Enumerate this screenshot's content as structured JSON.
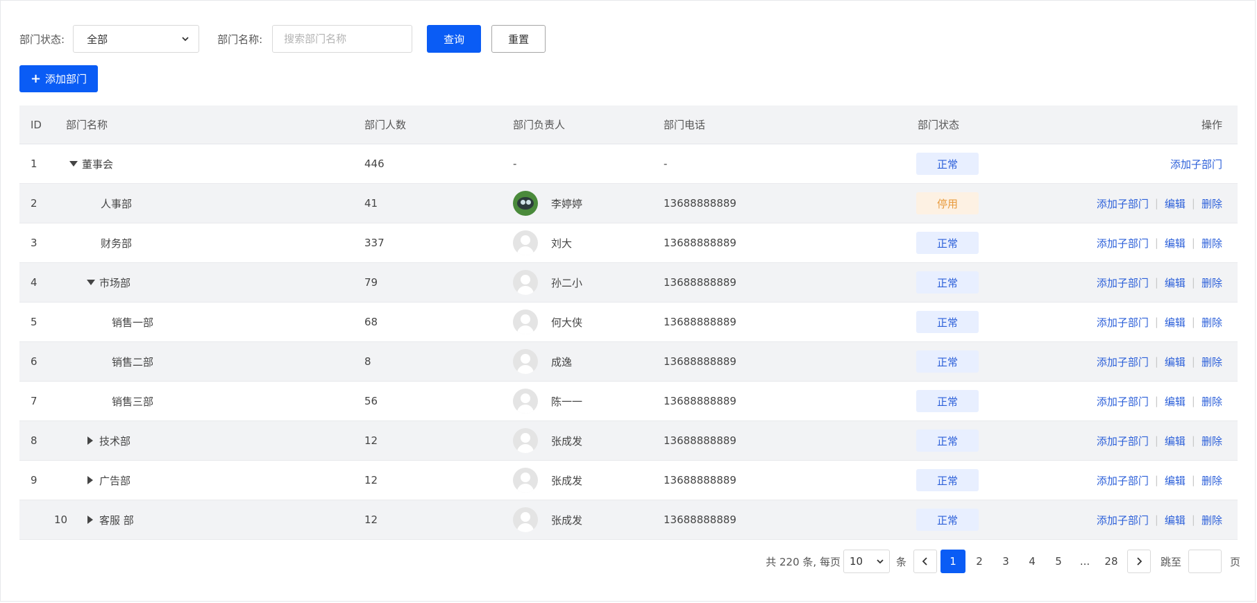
{
  "filters": {
    "status_label": "部门状态:",
    "status_value": "全部",
    "name_label": "部门名称:",
    "name_placeholder": "搜索部门名称",
    "query_button": "查询",
    "reset_button": "重置"
  },
  "add_button": "添加部门",
  "table": {
    "headers": {
      "id": "ID",
      "name": "部门名称",
      "count": "部门人数",
      "owner": "部门负责人",
      "phone": "部门电话",
      "status": "部门状态",
      "ops": "操作"
    },
    "op_labels": {
      "add_child": "添加子部门",
      "edit": "编辑",
      "delete": "删除",
      "separator": "|"
    },
    "rows": [
      {
        "id": "1",
        "name": "董事会",
        "count": "446",
        "owner": "-",
        "phone": "-",
        "status": "正常"
      },
      {
        "id": "2",
        "name": "人事部",
        "count": "41",
        "owner": "李婷婷",
        "phone": "13688888889",
        "status": "停用"
      },
      {
        "id": "3",
        "name": "财务部",
        "count": "337",
        "owner": "刘大",
        "phone": "13688888889",
        "status": "正常"
      },
      {
        "id": "4",
        "name": "市场部",
        "count": "79",
        "owner": "孙二小",
        "phone": "13688888889",
        "status": "正常"
      },
      {
        "id": "5",
        "name": "销售一部",
        "count": "68",
        "owner": "何大侠",
        "phone": "13688888889",
        "status": "正常"
      },
      {
        "id": "6",
        "name": "销售二部",
        "count": "8",
        "owner": "成逸",
        "phone": "13688888889",
        "status": "正常"
      },
      {
        "id": "7",
        "name": "销售三部",
        "count": "56",
        "owner": "陈一一",
        "phone": "13688888889",
        "status": "正常"
      },
      {
        "id": "8",
        "name": "技术部",
        "count": "12",
        "owner": "张成发",
        "phone": "13688888889",
        "status": "正常"
      },
      {
        "id": "9",
        "name": "广告部",
        "count": "12",
        "owner": "张成发",
        "phone": "13688888889",
        "status": "正常"
      },
      {
        "id": "10",
        "name": "客服 部",
        "count": "12",
        "owner": "张成发",
        "phone": "13688888889",
        "status": "正常"
      }
    ]
  },
  "pagination": {
    "total_text": "共 220 条, 每页",
    "page_size": "10",
    "unit": "条",
    "pages": [
      "1",
      "2",
      "3",
      "4",
      "5",
      "...",
      "28"
    ],
    "current": "1",
    "jump_label": "跳至",
    "page_suffix": "页"
  },
  "colors": {
    "primary": "#0a5cf5",
    "status_normal_bg": "#e8efff",
    "status_normal_text": "#2b5fd9",
    "status_disabled_bg": "#fdf1e3",
    "status_disabled_text": "#e89a3c"
  },
  "icons": [
    "chevron-down-icon",
    "plus-icon",
    "caret-down-icon",
    "caret-right-icon",
    "avatar-placeholder-icon",
    "chevron-left-icon",
    "chevron-right-icon"
  ]
}
